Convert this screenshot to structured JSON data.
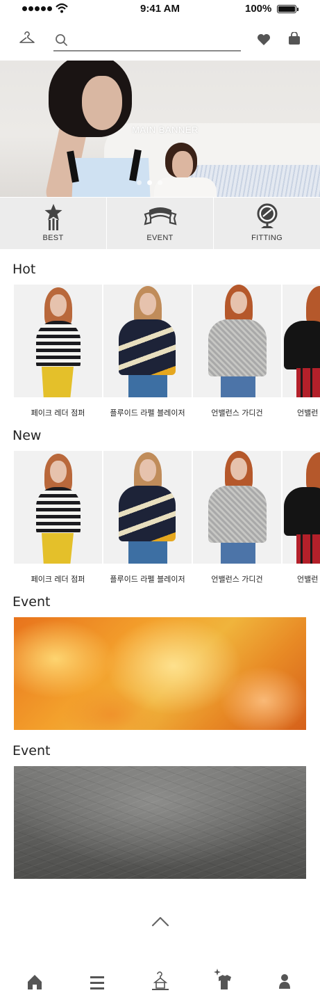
{
  "status_bar": {
    "time": "9:41 AM",
    "battery_percent": "100%"
  },
  "header": {
    "search_placeholder": "",
    "icons": [
      "hanger-icon",
      "search-icon",
      "heart-icon",
      "shopping-bag-icon"
    ]
  },
  "banner": {
    "label": "MAIN BANNER",
    "slide_count": 3,
    "active_slide": 2
  },
  "categories": [
    {
      "label": "BEST",
      "icon": "star-icon"
    },
    {
      "label": "EVENT",
      "icon": "ribbon-icon"
    },
    {
      "label": "FITTING",
      "icon": "mirror-icon"
    }
  ],
  "sections": {
    "hot": {
      "title": "Hot",
      "products": [
        {
          "name": "페이크 레더 점퍼"
        },
        {
          "name": "플루이드 라펠 블레이저"
        },
        {
          "name": "언밸런스 가디건"
        },
        {
          "name": "언밸런"
        }
      ]
    },
    "new": {
      "title": "New",
      "products": [
        {
          "name": "페이크 레더 점퍼"
        },
        {
          "name": "플루이드 라펠 블레이저"
        },
        {
          "name": "언밸런스 가디건"
        },
        {
          "name": "언밸런"
        }
      ]
    },
    "event1": {
      "title": "Event"
    },
    "event2": {
      "title": "Event"
    }
  },
  "bottom_nav": [
    "home-icon",
    "menu-icon",
    "closet-icon",
    "recommend-icon",
    "profile-icon"
  ],
  "colors": {
    "accent_dark": "#555555",
    "category_bg": "#ececec",
    "event_orange": "#f0a02c",
    "event_gray": "#5e5e5c"
  }
}
